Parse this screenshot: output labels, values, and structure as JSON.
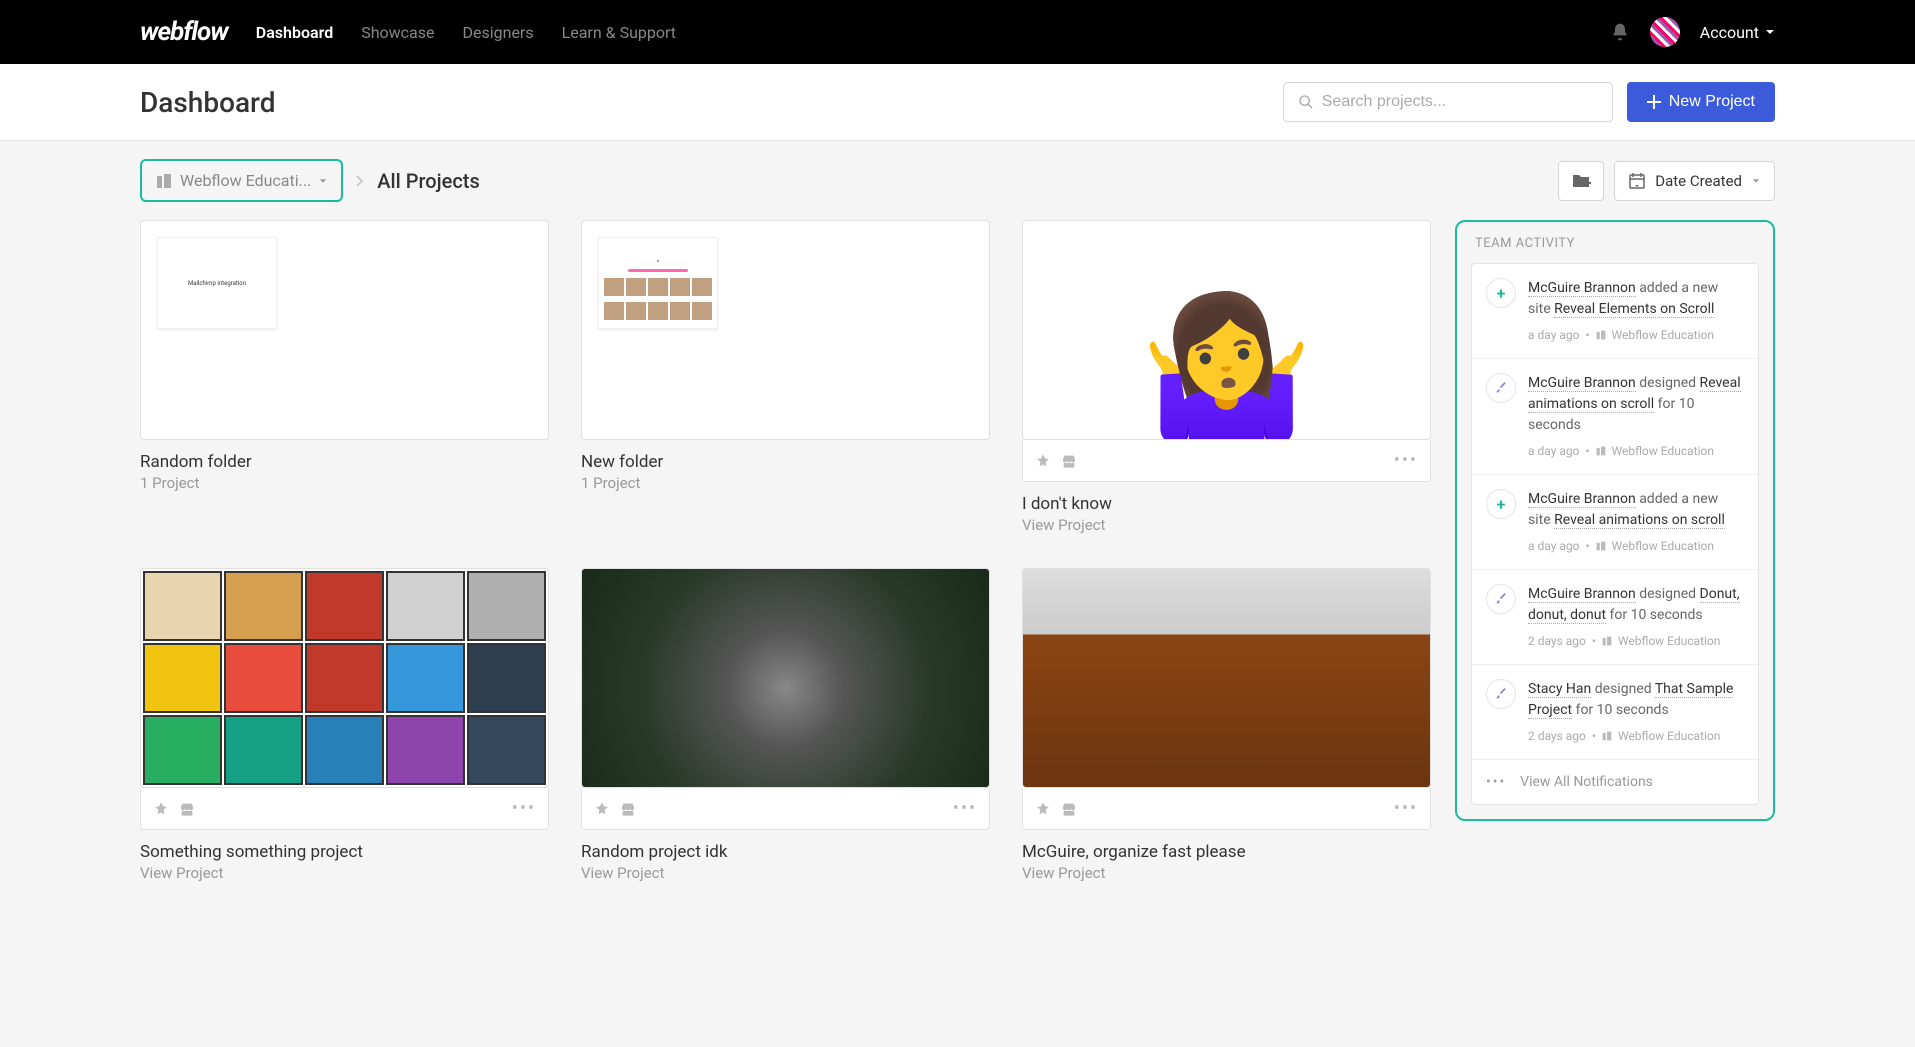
{
  "nav": {
    "logo": "webflow",
    "links": [
      "Dashboard",
      "Showcase",
      "Designers",
      "Learn & Support"
    ],
    "active_index": 0,
    "account_label": "Account"
  },
  "header": {
    "title": "Dashboard",
    "search_placeholder": "Search projects...",
    "new_project_label": "New Project"
  },
  "breadcrumb": {
    "team_name": "Webflow Educati...",
    "current": "All Projects",
    "sort_label": "Date Created"
  },
  "projects": [
    {
      "title": "Random folder",
      "sub": "1 Project",
      "type": "folder",
      "thumb_text": "Mailchimp integration"
    },
    {
      "title": "New folder",
      "sub": "1 Project",
      "type": "folder",
      "thumb_text": ""
    },
    {
      "title": "I don't know",
      "sub": "View Project",
      "type": "project",
      "thumb": "emoji"
    },
    {
      "title": "Something something project",
      "sub": "View Project",
      "type": "project",
      "thumb": "paint"
    },
    {
      "title": "Random project idk",
      "sub": "View Project",
      "type": "project",
      "thumb": "wolf"
    },
    {
      "title": "McGuire, organize fast please",
      "sub": "View Project",
      "type": "project",
      "thumb": "desk"
    }
  ],
  "activity": {
    "title": "TEAM ACTIVITY",
    "footer_label": "View All Notifications",
    "items": [
      {
        "icon": "plus",
        "user": "McGuire Brannon",
        "action": " added a new site ",
        "target": "Reveal Elements on Scroll",
        "suffix": "",
        "time": "a day ago",
        "team": "Webflow Education"
      },
      {
        "icon": "brush",
        "user": "McGuire Brannon",
        "action": " designed ",
        "target": "Reveal animations on scroll",
        "suffix": " for 10 seconds",
        "time": "a day ago",
        "team": "Webflow Education"
      },
      {
        "icon": "plus",
        "user": "McGuire Brannon",
        "action": " added a new site ",
        "target": "Reveal animations on scroll",
        "suffix": "",
        "time": "a day ago",
        "team": "Webflow Education"
      },
      {
        "icon": "brush",
        "user": "McGuire Brannon",
        "action": " designed ",
        "target": "Donut, donut, donut",
        "suffix": " for 10 seconds",
        "time": "2 days ago",
        "team": "Webflow Education"
      },
      {
        "icon": "brush",
        "user": "Stacy Han",
        "action": " designed ",
        "target": "That Sample Project",
        "suffix": " for 10 seconds",
        "time": "2 days ago",
        "team": "Webflow Education"
      }
    ]
  },
  "colors": {
    "accent_teal": "#1abc9c",
    "primary_blue": "#3b5bdb"
  }
}
